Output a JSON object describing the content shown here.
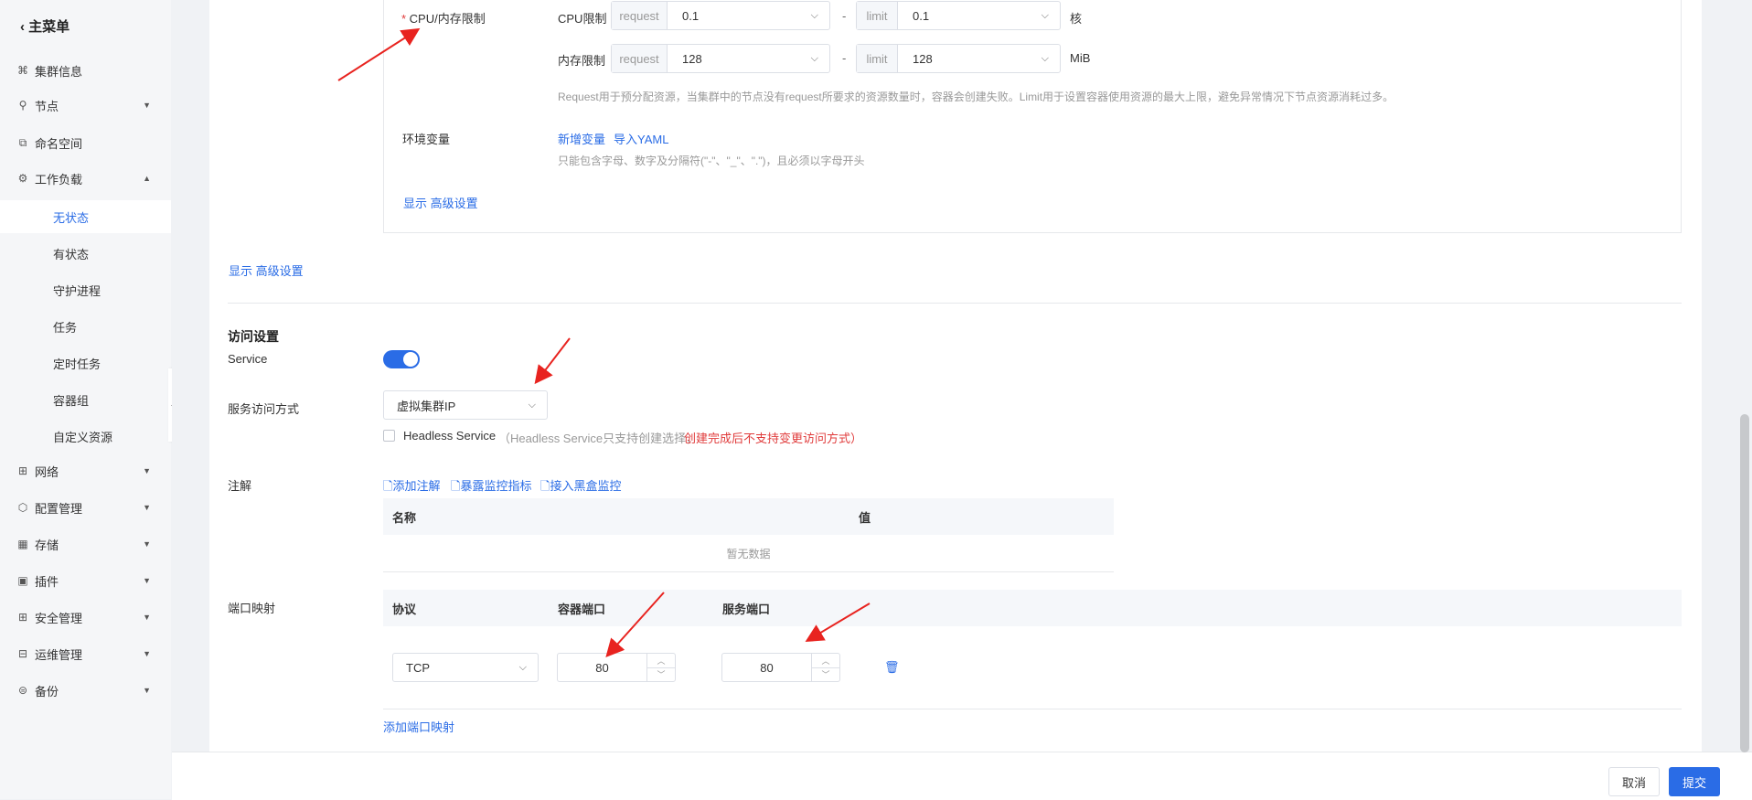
{
  "sidebar": {
    "back_label": "主菜单",
    "items": [
      {
        "label": "集群信息",
        "icon": "cluster-icon"
      },
      {
        "label": "节点",
        "icon": "node-icon"
      },
      {
        "label": "命名空间",
        "icon": "namespace-icon"
      },
      {
        "label": "工作负载",
        "icon": "workload-icon"
      },
      {
        "label": "网络",
        "icon": "network-icon"
      },
      {
        "label": "配置管理",
        "icon": "config-icon"
      },
      {
        "label": "存储",
        "icon": "storage-icon"
      },
      {
        "label": "插件",
        "icon": "plugin-icon"
      },
      {
        "label": "安全管理",
        "icon": "security-icon"
      },
      {
        "label": "运维管理",
        "icon": "ops-icon"
      },
      {
        "label": "备份",
        "icon": "backup-icon"
      }
    ],
    "workload_sub": [
      "无状态",
      "有状态",
      "守护进程",
      "任务",
      "定时任务",
      "容器组",
      "自定义资源"
    ],
    "active_sub": "无状态"
  },
  "resources": {
    "label": "CPU/内存限制",
    "cpu_label": "CPU限制",
    "mem_label": "内存限制",
    "request_addon": "request",
    "limit_addon": "limit",
    "cpu_request": "0.1",
    "cpu_limit": "0.1",
    "cpu_unit": "核",
    "mem_request": "128",
    "mem_limit": "128",
    "mem_unit": "MiB",
    "dash": "-",
    "hint": "Request用于预分配资源，当集群中的节点没有request所要求的资源数量时，容器会创建失败。Limit用于设置容器使用资源的最大上限，避免异常情况下节点资源消耗过多。"
  },
  "env": {
    "label": "环境变量",
    "add_link": "新增变量",
    "import_link": "导入YAML",
    "hint": "只能包含字母、数字及分隔符(\"-\"、\"_\"、\".\")，且必须以字母开头"
  },
  "advanced_inner": "显示 高级设置",
  "advanced_outer": "显示 高级设置",
  "access": {
    "title": "访问设置",
    "service_label": "Service",
    "service_enabled": true,
    "method_label": "服务访问方式",
    "method_value": "虚拟集群IP",
    "headless_label": "Headless Service",
    "headless_hint": "（Headless Service只支持创建选择，",
    "headless_warn": "创建完成后不支持变更访问方式）"
  },
  "annotations": {
    "label": "注解",
    "add": "添加注解",
    "expose": "暴露监控指标",
    "blackbox": "接入黑盒监控",
    "col_name": "名称",
    "col_value": "值",
    "empty": "暂无数据"
  },
  "ports": {
    "label": "端口映射",
    "col_protocol": "协议",
    "col_container": "容器端口",
    "col_service": "服务端口",
    "protocol": "TCP",
    "container_port": "80",
    "service_port": "80",
    "add": "添加端口映射"
  },
  "footer": {
    "cancel": "取消",
    "submit": "提交"
  },
  "colors": {
    "primary": "#2a6ce6",
    "required": "#e03b3b",
    "annotation_arrow": "#e8231f"
  }
}
